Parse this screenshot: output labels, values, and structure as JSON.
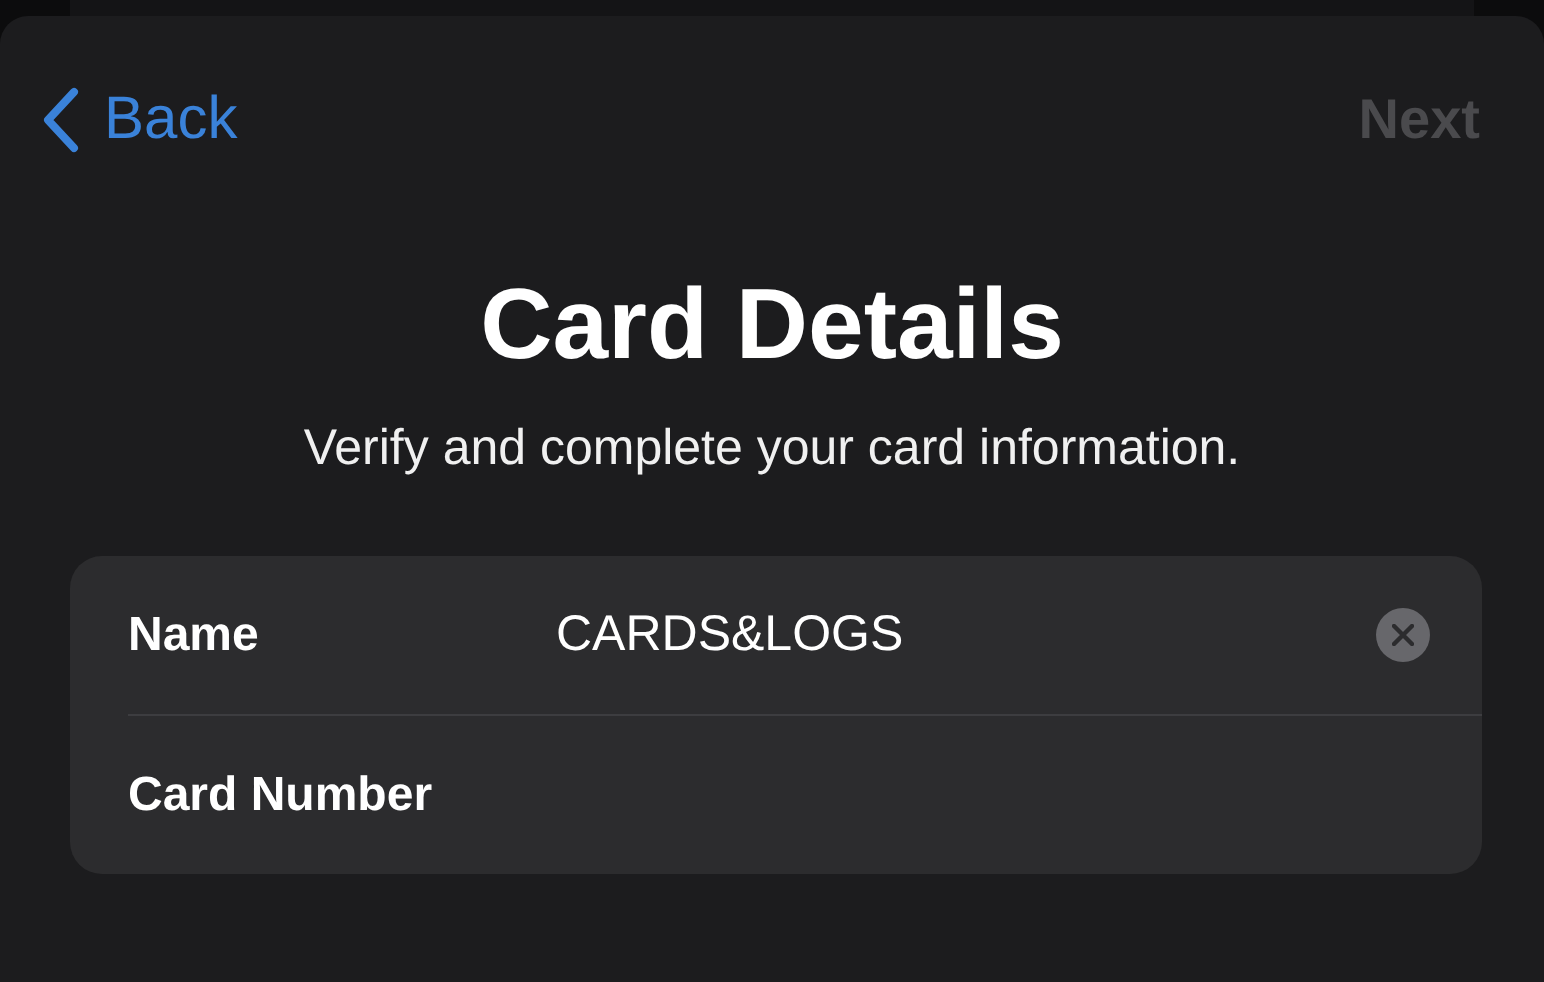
{
  "nav": {
    "back": "Back",
    "next": {
      "label": "Next",
      "disabled": true
    }
  },
  "title": "Card Details",
  "subtitle": "Verify and complete your card information.",
  "fields": [
    {
      "label": "Name",
      "value": "CARDS&LOGS",
      "clear_button": true
    },
    {
      "label": "Card Number",
      "clear_button": false
    }
  ]
}
